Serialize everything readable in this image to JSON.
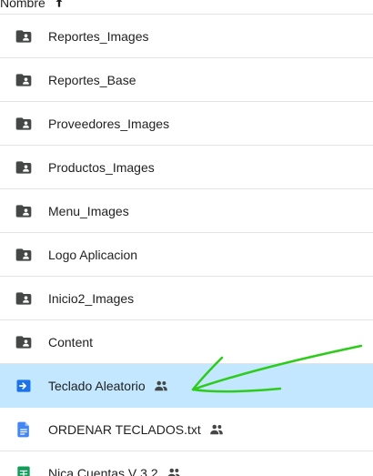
{
  "header": {
    "name_column": "Nombre"
  },
  "rows": [
    {
      "label": "Reportes_Images",
      "type": "folder-shared",
      "shared": false
    },
    {
      "label": "Reportes_Base",
      "type": "folder-shared",
      "shared": false
    },
    {
      "label": "Proveedores_Images",
      "type": "folder-shared",
      "shared": false
    },
    {
      "label": "Productos_Images",
      "type": "folder-shared",
      "shared": false
    },
    {
      "label": "Menu_Images",
      "type": "folder-shared",
      "shared": false
    },
    {
      "label": "Logo Aplicacion",
      "type": "folder-shared",
      "shared": false
    },
    {
      "label": "Inicio2_Images",
      "type": "folder-shared",
      "shared": false
    },
    {
      "label": "Content",
      "type": "folder-shared",
      "shared": false
    },
    {
      "label": "Teclado Aleatorio",
      "type": "shortcut",
      "shared": true,
      "selected": true
    },
    {
      "label": "ORDENAR TECLADOS.txt",
      "type": "document",
      "shared": true
    },
    {
      "label": "Nica Cuentas V 3.2",
      "type": "spreadsheet",
      "shared": true
    }
  ],
  "colors": {
    "folder": "#444746",
    "selected_bg": "#c2e7ff",
    "shortcut_blue": "#1a73e8",
    "doc_blue": "#4285f4",
    "sheet_green": "#0f9d58",
    "annotation_green": "#2ecc1a"
  }
}
